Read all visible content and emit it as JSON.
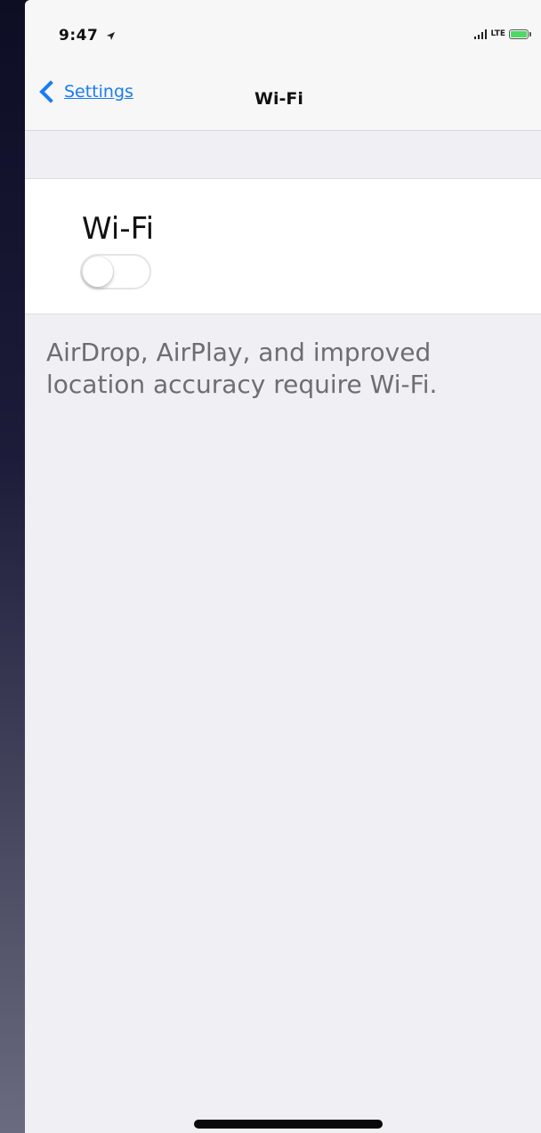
{
  "status_bar": {
    "time": "9:47",
    "location_icon": "location-arrow-icon",
    "carrier": "LTE",
    "signal_icon": "cellular-signal-icon",
    "battery_icon": "battery-charging-icon",
    "battery_color": "#4cd964"
  },
  "nav": {
    "back_label": "Settings",
    "back_icon": "chevron-left-icon",
    "title": "Wi-Fi",
    "accent_color": "#1a7cf5"
  },
  "wifi_cell": {
    "label": "Wi-Fi",
    "toggle_on": false
  },
  "footer_note": "AirDrop, AirPlay, and improved location accuracy require Wi-Fi."
}
